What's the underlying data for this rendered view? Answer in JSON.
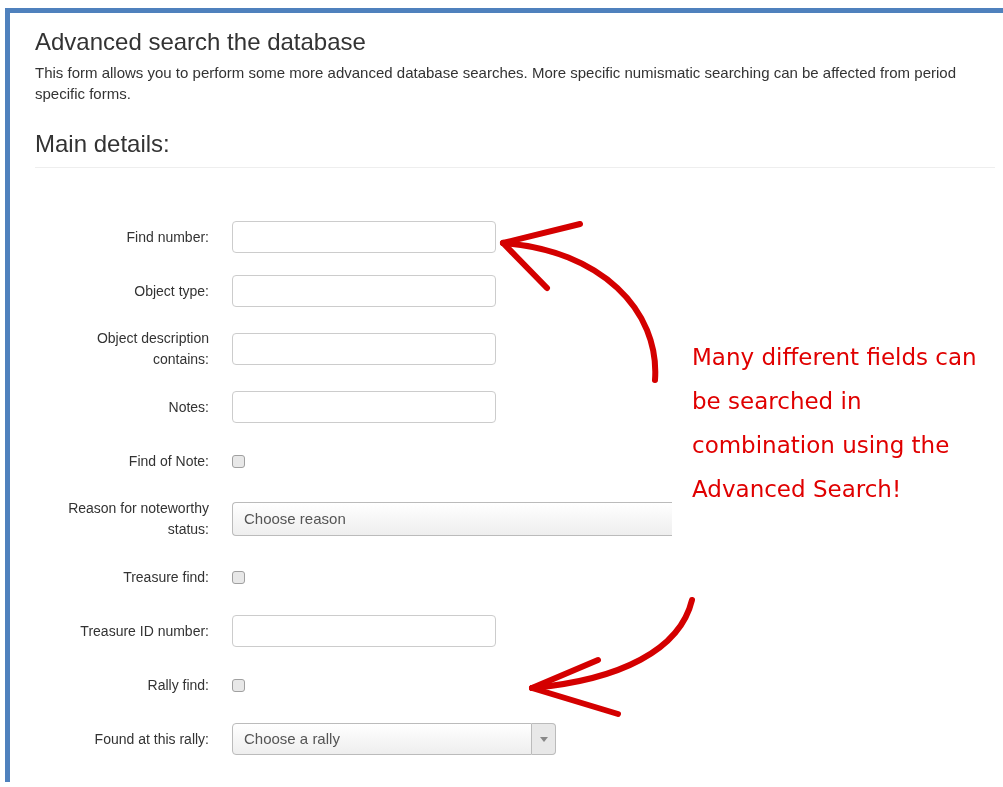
{
  "page": {
    "title": "Advanced search the database",
    "description": "This form allows you to perform some more advanced database searches. More specific numismatic searching can be affected from period specific forms."
  },
  "section": {
    "title": "Main details:"
  },
  "fields": [
    {
      "kind": "text",
      "label": "Find number:"
    },
    {
      "kind": "text",
      "label": "Object type:"
    },
    {
      "kind": "text",
      "label": "Object description contains:"
    },
    {
      "kind": "text",
      "label": "Notes:"
    },
    {
      "kind": "checkbox",
      "label": "Find of Note:",
      "checked": false
    },
    {
      "kind": "select",
      "label": "Reason for noteworthy status:",
      "value": "Choose reason"
    },
    {
      "kind": "checkbox",
      "label": "Treasure find:",
      "checked": false
    },
    {
      "kind": "text",
      "label": "Treasure ID number:"
    },
    {
      "kind": "checkbox",
      "label": "Rally find:",
      "checked": false
    },
    {
      "kind": "combo",
      "label": "Found at this rally:",
      "value": "Choose a rally"
    }
  ],
  "annotation": {
    "text": "Many different fields can be searched in combination using the Advanced Search!"
  }
}
